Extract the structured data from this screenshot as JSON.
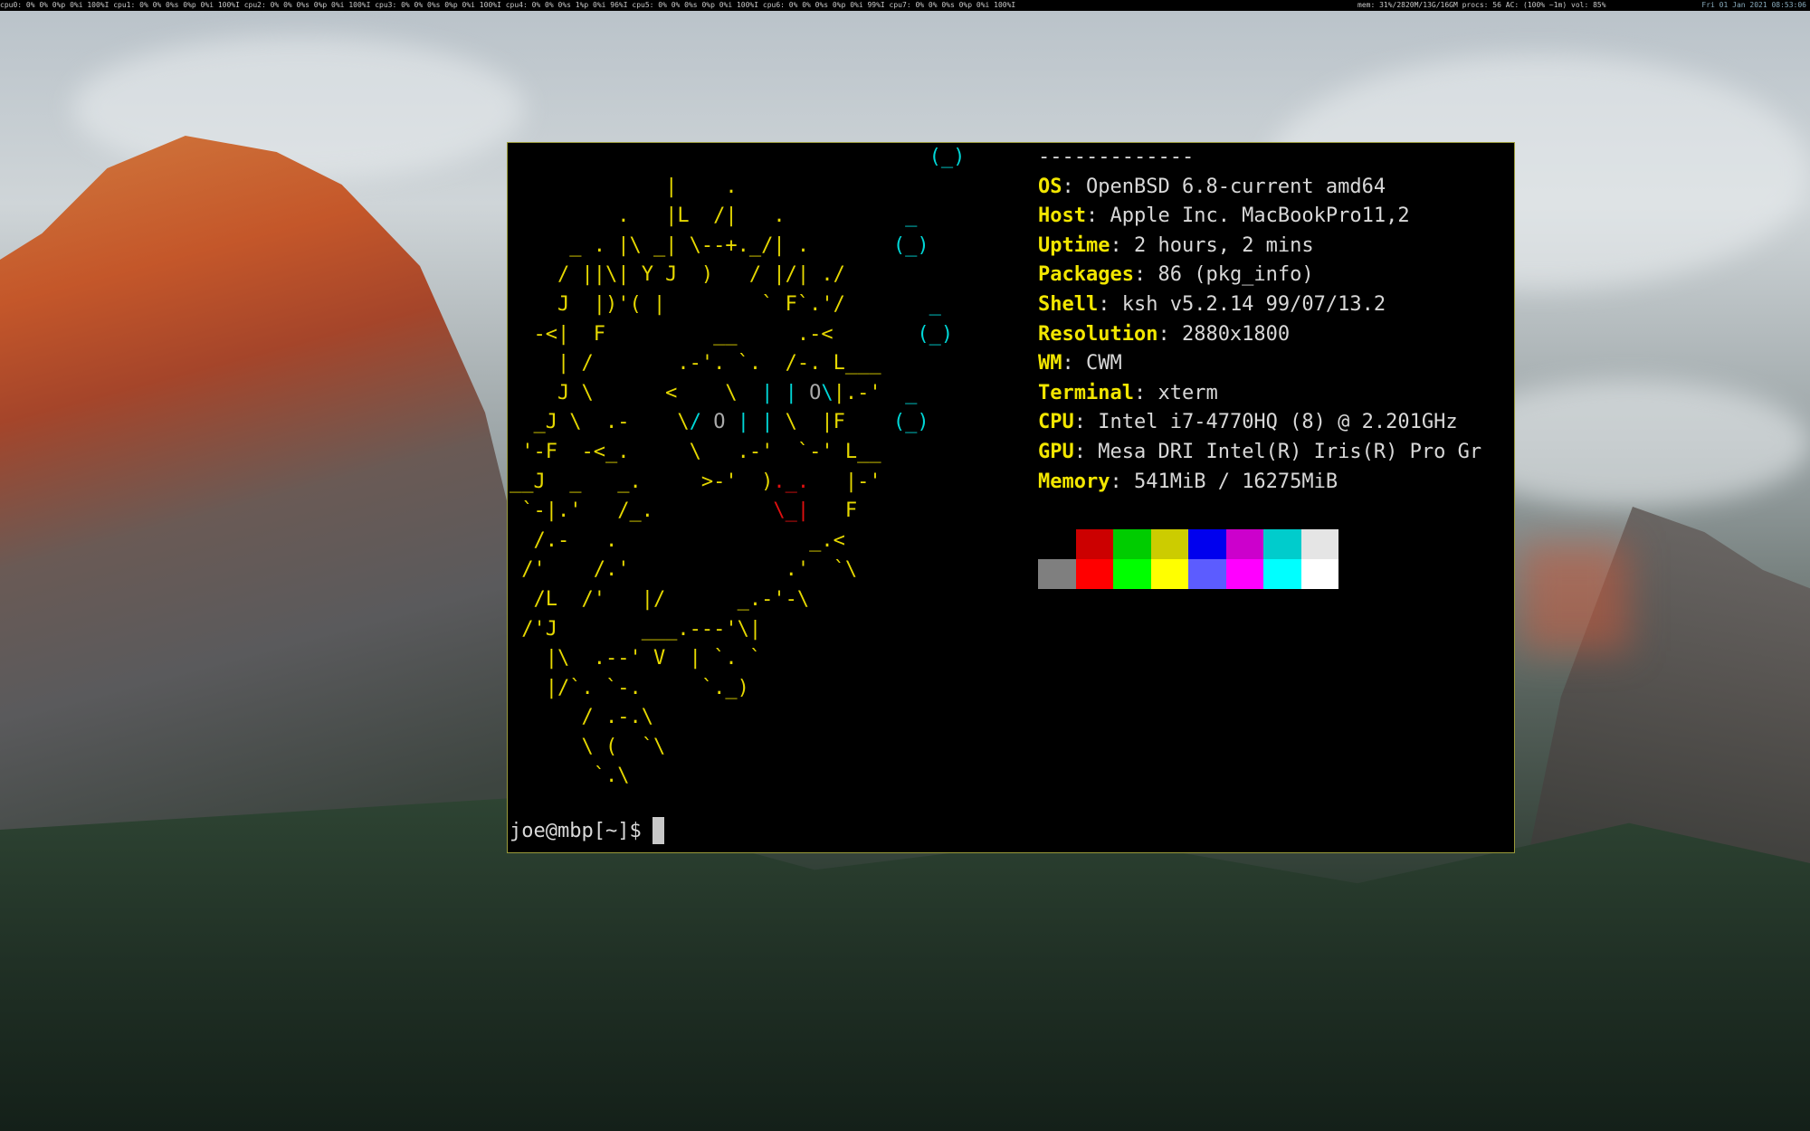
{
  "statusbar": {
    "left_text": "cpu0: 0% 0% 0%p 0%i 100%I  cpu1: 0% 0% 0%s 0%p 0%i 100%I  cpu2: 0% 0% 0%s 0%p 0%i 100%I  cpu3: 0% 0% 0%s 0%p 0%i 100%I  cpu4: 0% 0% 0%s 1%p 0%i 96%I  cpu5: 0% 0% 0%s 0%p 0%i 100%I  cpu6: 0% 0% 0%s 0%p 0%i 99%I  cpu7: 0% 0% 0%s 0%p 0%i 100%I",
    "mid_text": "mem: 31%/2820M/13G/16GM  procs: 56  AC: (100% ~1m)  vol: 85%",
    "clock": "Fri 01 Jan 2021 08:53:06",
    "colors": {
      "green": "#00cc00",
      "blue": "#3040e0",
      "magenta": "#d020d0"
    }
  },
  "terminal": {
    "ascii_art": [
      "                                  ",
      "             |    .               ",
      "         .   |L  /|   .           ",
      "     _ . |\\ _| \\--+._/| .         ",
      "    / ||\\| Y J  )   / |/| ./      ",
      "    J  |)'( |        ` F`.'/      ",
      "  -<|  F         __     .-<       ",
      "    | /       .-'. `.  /-. L___   ",
      "    J \\      <    \\  | | O\\|.-'   ",
      "  _J \\  .-    \\/ O | | \\  |F     ",
      " '-F  -<_.     \\   .-'  `-' L__  ",
      "__J  _   _.     >-'  )._.   |-'  ",
      " `-|.'   /_.          \\_|   F    ",
      "  /.-   .                _.<     ",
      " /'    /.'             .'  `\\    ",
      "  /L  /'   |/      _.-'-\\        ",
      " /'J       ___.---'\\|            ",
      "   |\\  .--' V  | `. `            ",
      "   |/`. `-.     `._)             ",
      "      / .-.\\                     ",
      "      \\ (  `\\                    ",
      "       `.\\                       "
    ],
    "puffer_glyphs": {
      "p1": "(_)",
      "p2_top": "_",
      "p2": "(_)",
      "p3_top": "_",
      "p3": "(_)",
      "p4_top": "_",
      "p4": "(_)"
    },
    "info": {
      "separator": "-------------",
      "rows": [
        {
          "key": "OS",
          "value": "OpenBSD 6.8-current amd64"
        },
        {
          "key": "Host",
          "value": "Apple Inc. MacBookPro11,2"
        },
        {
          "key": "Uptime",
          "value": "2 hours, 2 mins"
        },
        {
          "key": "Packages",
          "value": "86 (pkg_info)"
        },
        {
          "key": "Shell",
          "value": "ksh v5.2.14 99/07/13.2"
        },
        {
          "key": "Resolution",
          "value": "2880x1800"
        },
        {
          "key": "WM",
          "value": "CWM"
        },
        {
          "key": "Terminal",
          "value": "xterm"
        },
        {
          "key": "CPU",
          "value": "Intel i7-4770HQ (8) @ 2.201GHz"
        },
        {
          "key": "GPU",
          "value": "Mesa DRI Intel(R) Iris(R) Pro Gr"
        },
        {
          "key": "Memory",
          "value": "541MiB / 16275MiB"
        }
      ]
    },
    "palette": {
      "row1": [
        "#000000",
        "#cc0000",
        "#00cc00",
        "#cccc00",
        "#0000ee",
        "#cc00cc",
        "#00cccc",
        "#e5e5e5"
      ],
      "row2": [
        "#7f7f7f",
        "#ff0000",
        "#00ff00",
        "#ffff00",
        "#5c5cff",
        "#ff00ff",
        "#00ffff",
        "#ffffff"
      ]
    },
    "prompt": "joe@mbp[~]$"
  }
}
